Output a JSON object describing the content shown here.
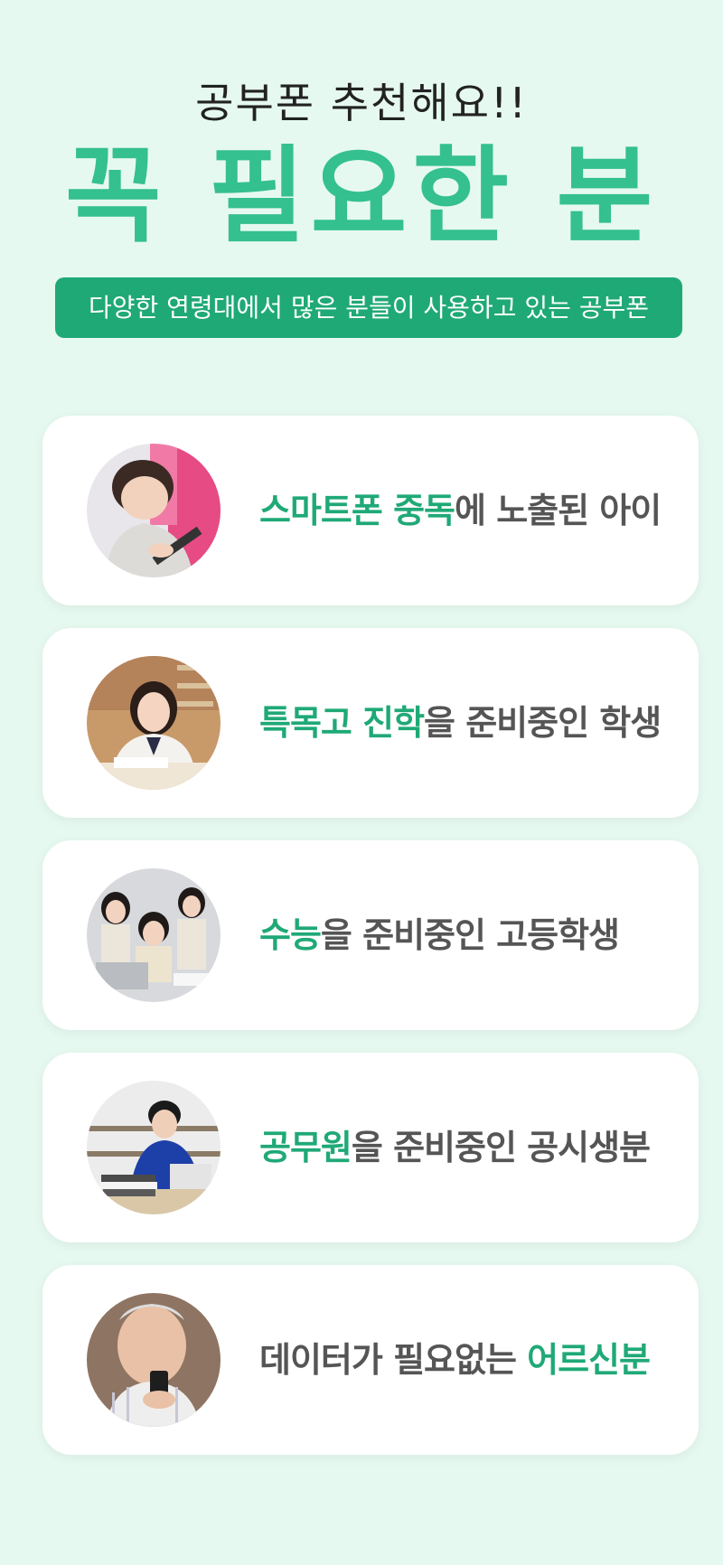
{
  "header": {
    "subtitle": "공부폰 추천해요!!",
    "headline": "꼭 필요한 분",
    "banner": "다양한 연령대에서 많은 분들이 사용하고 있는 공부폰"
  },
  "colors": {
    "background": "#e6f9f0",
    "accent": "#34c08f",
    "banner": "#1fa977",
    "highlight_text": "#1fa977",
    "body_text": "#555555"
  },
  "cards": [
    {
      "highlight": "스마트폰 중독",
      "rest": "에 노출된 아이",
      "photo": "child-with-tablet"
    },
    {
      "highlight": "특목고 진학",
      "rest": "을 준비중인 학생",
      "photo": "student-studying"
    },
    {
      "highlight": "수능",
      "rest": "을 준비중인 고등학생",
      "photo": "high-school-students"
    },
    {
      "highlight": "공무원",
      "rest": "을 준비중인 공시생분",
      "photo": "exam-candidate-with-laptop"
    },
    {
      "prefix": "데이터가 필요없는 ",
      "highlight": "어르신분",
      "photo": "elderly-man-with-phone"
    }
  ]
}
